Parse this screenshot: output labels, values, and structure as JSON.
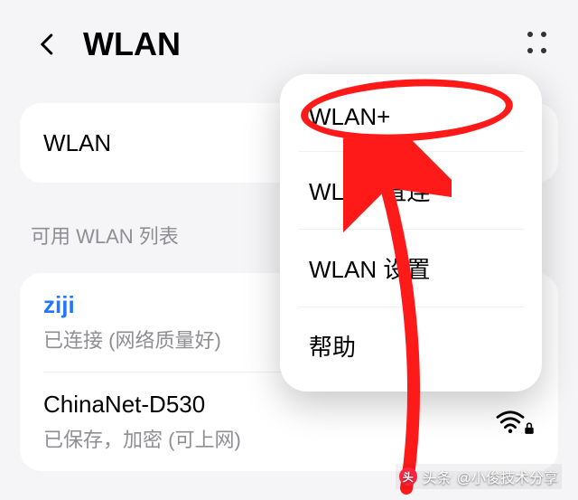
{
  "header": {
    "title": "WLAN"
  },
  "wlan_toggle": {
    "label": "WLAN",
    "on": true
  },
  "section": {
    "available_label": "可用 WLAN 列表"
  },
  "networks": [
    {
      "ssid": "ziji",
      "status": "已连接 (网络质量好)",
      "connected": true,
      "locked": true
    },
    {
      "ssid": "ChinaNet-D530",
      "status": "已保存，加密 (可上网)",
      "connected": false,
      "locked": true
    }
  ],
  "menu": {
    "items": [
      "WLAN+",
      "WLAN 直连",
      "WLAN 设置",
      "帮助"
    ]
  },
  "watermark": {
    "prefix": "头条",
    "author": "@小俊技术分享"
  },
  "colors": {
    "accent": "#2566ff",
    "annotation": "#ff1a1a"
  }
}
